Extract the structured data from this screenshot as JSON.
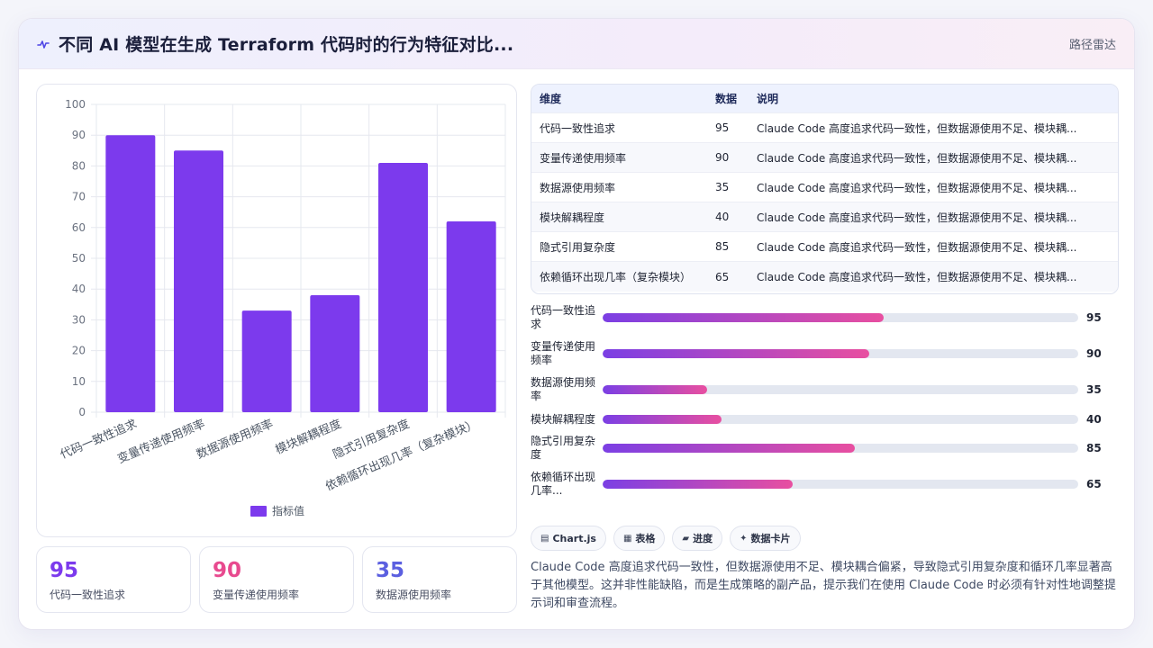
{
  "header": {
    "title": "不同 AI 模型在生成 Terraform 代码时的行为特征对比...",
    "right_label": "路径雷达"
  },
  "colors": {
    "bar": "#7c3aed",
    "gradient_start": "#7b3fe4",
    "gradient_end": "#e84fa0",
    "stat_purple": "#7c3aed",
    "stat_pink": "#e84a8f",
    "stat_indigo": "#5b5fe0"
  },
  "chart_data": {
    "type": "bar",
    "categories": [
      "代码一致性追求",
      "变量传递使用频率",
      "数据源使用频率",
      "模块解耦程度",
      "隐式引用复杂度",
      "依赖循环出现几率（复杂模块）"
    ],
    "series": [
      {
        "name": "指标值",
        "values": [
          90,
          85,
          33,
          38,
          81,
          62
        ]
      }
    ],
    "ylim": [
      0,
      100
    ],
    "yticks": [
      0,
      10,
      20,
      30,
      40,
      50,
      60,
      70,
      80,
      90,
      100
    ],
    "grid": true,
    "legend": "bottom",
    "xlabel": "",
    "ylabel": ""
  },
  "stats": [
    {
      "value": "95",
      "label": "代码一致性追求"
    },
    {
      "value": "90",
      "label": "变量传递使用频率"
    },
    {
      "value": "35",
      "label": "数据源使用频率"
    }
  ],
  "table": {
    "headers": [
      "维度",
      "数据",
      "说明"
    ],
    "rows": [
      {
        "dim": "代码一致性追求",
        "val": "95",
        "desc": "Claude Code 高度追求代码一致性，但数据源使用不足、模块耦..."
      },
      {
        "dim": "变量传递使用频率",
        "val": "90",
        "desc": "Claude Code 高度追求代码一致性，但数据源使用不足、模块耦..."
      },
      {
        "dim": "数据源使用频率",
        "val": "35",
        "desc": "Claude Code 高度追求代码一致性，但数据源使用不足、模块耦..."
      },
      {
        "dim": "模块解耦程度",
        "val": "40",
        "desc": "Claude Code 高度追求代码一致性，但数据源使用不足、模块耦..."
      },
      {
        "dim": "隐式引用复杂度",
        "val": "85",
        "desc": "Claude Code 高度追求代码一致性，但数据源使用不足、模块耦..."
      },
      {
        "dim": "依赖循环出现几率（复杂模块）",
        "val": "65",
        "desc": "Claude Code 高度追求代码一致性，但数据源使用不足、模块耦..."
      }
    ]
  },
  "progress": [
    {
      "label": "代码一致性追求",
      "value": "95",
      "fill_percent": 59
    },
    {
      "label": "变量传递使用频率",
      "value": "90",
      "fill_percent": 56
    },
    {
      "label": "数据源使用频率",
      "value": "35",
      "fill_percent": 22
    },
    {
      "label": "模块解耦程度",
      "value": "40",
      "fill_percent": 25
    },
    {
      "label": "隐式引用复杂度",
      "value": "85",
      "fill_percent": 53
    },
    {
      "label": "依赖循环出现几率...",
      "value": "65",
      "fill_percent": 40
    }
  ],
  "chips": [
    {
      "icon": "chart-icon",
      "glyph": "▤",
      "label": "Chart.js"
    },
    {
      "icon": "table-icon",
      "glyph": "▦",
      "label": "表格"
    },
    {
      "icon": "progress-icon",
      "glyph": "▰",
      "label": "进度"
    },
    {
      "icon": "card-icon",
      "glyph": "✦",
      "label": "数据卡片"
    }
  ],
  "summary": "Claude Code 高度追求代码一致性，但数据源使用不足、模块耦合偏紧，导致隐式引用复杂度和循环几率显著高于其他模型。这并非性能缺陷，而是生成策略的副产品，提示我们在使用 Claude Code 时必须有针对性地调整提示词和审查流程。"
}
